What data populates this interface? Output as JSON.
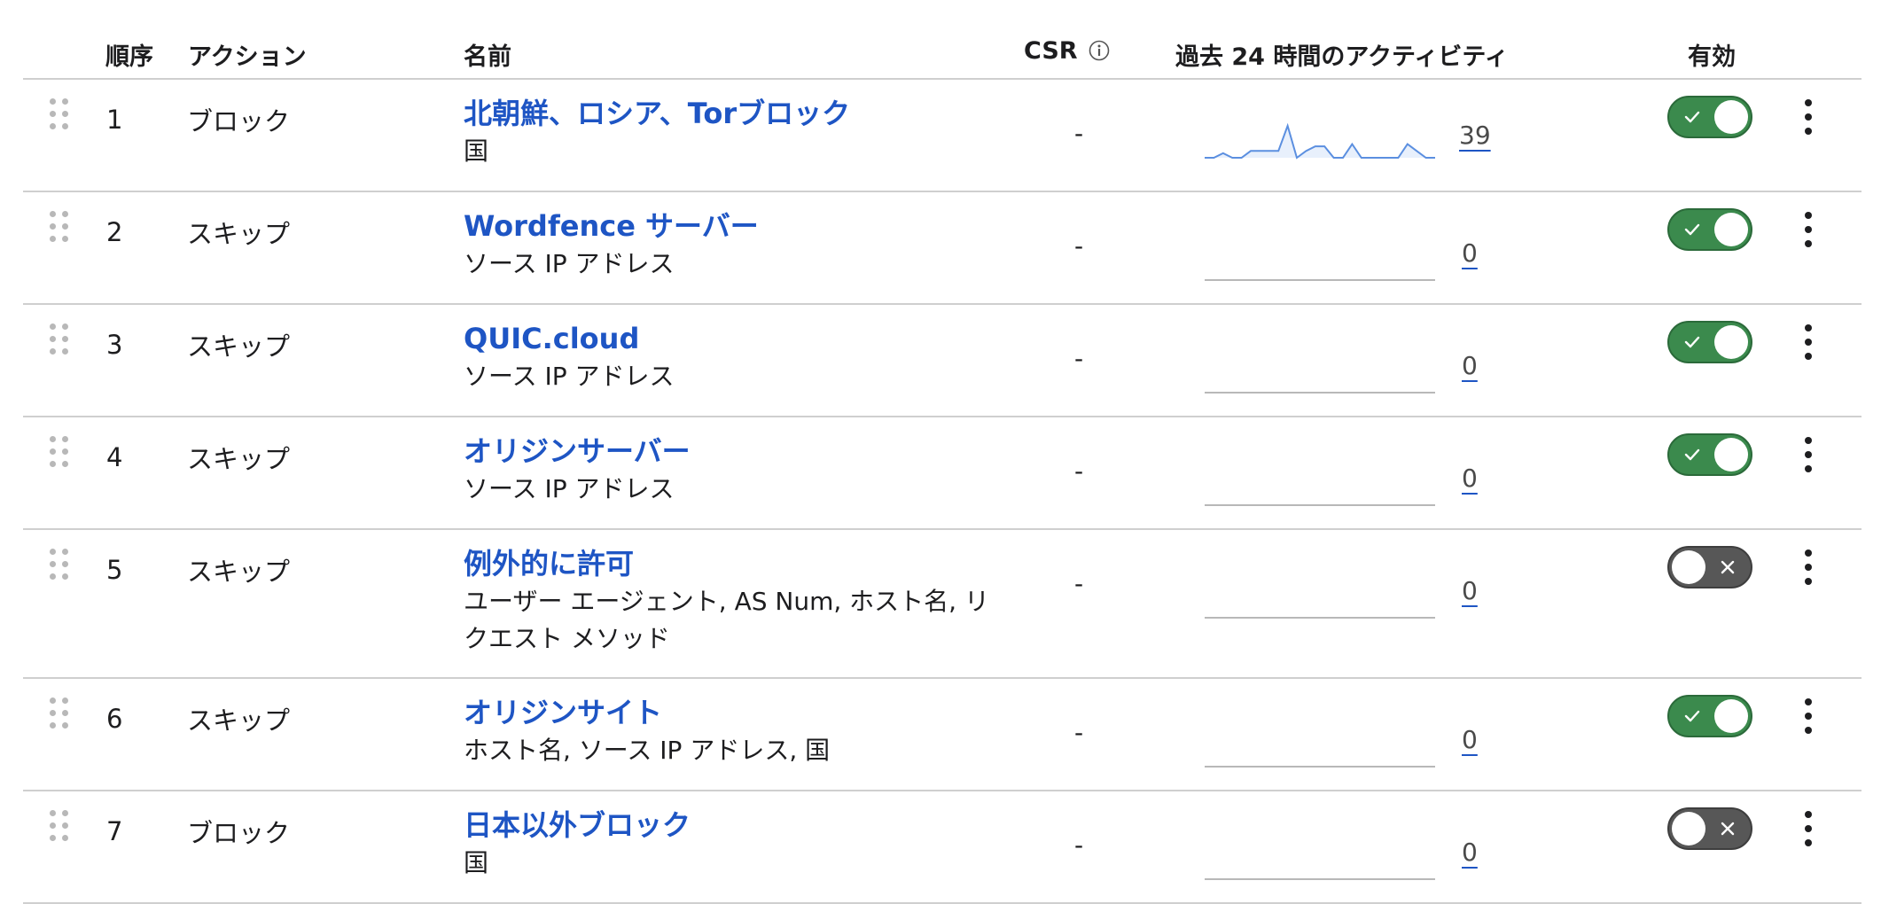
{
  "header": {
    "order": "順序",
    "action": "アクション",
    "name": "名前",
    "csr": "CSR",
    "activity": "過去 24 時間のアクティビティ",
    "enabled": "有効"
  },
  "rules": [
    {
      "order": "1",
      "action": "ブロック",
      "name": "北朝鮮、ロシア、Torブロック",
      "sub": "国",
      "csr": "-",
      "count": "39",
      "enabled": true,
      "activity": [
        0,
        0,
        2,
        0,
        0,
        3,
        3,
        3,
        3,
        14,
        0,
        3,
        5,
        5,
        0,
        0,
        6,
        0,
        0,
        0,
        0,
        0,
        6,
        3,
        0,
        0
      ]
    },
    {
      "order": "2",
      "action": "スキップ",
      "name": "Wordfence サーバー",
      "sub": "ソース IP アドレス",
      "csr": "-",
      "count": "0",
      "enabled": true,
      "activity": []
    },
    {
      "order": "3",
      "action": "スキップ",
      "name": "QUIC.cloud",
      "sub": "ソース IP アドレス",
      "csr": "-",
      "count": "0",
      "enabled": true,
      "activity": []
    },
    {
      "order": "4",
      "action": "スキップ",
      "name": "オリジンサーバー",
      "sub": "ソース IP アドレス",
      "csr": "-",
      "count": "0",
      "enabled": true,
      "activity": []
    },
    {
      "order": "5",
      "action": "スキップ",
      "name": "例外的に許可",
      "sub": "ユーザー エージェント, AS Num, ホスト名, リクエスト メソッド",
      "csr": "-",
      "count": "0",
      "enabled": false,
      "activity": []
    },
    {
      "order": "6",
      "action": "スキップ",
      "name": "オリジンサイト",
      "sub": "ホスト名, ソース IP アドレス, 国",
      "csr": "-",
      "count": "0",
      "enabled": true,
      "activity": []
    },
    {
      "order": "7",
      "action": "ブロック",
      "name": "日本以外ブロック",
      "sub": "国",
      "csr": "-",
      "count": "0",
      "enabled": false,
      "activity": []
    }
  ],
  "colors": {
    "link": "#1e55c4",
    "toggle_on": "#3b8a4d",
    "toggle_off": "#575757",
    "sparkline": "#5b8fe0"
  }
}
